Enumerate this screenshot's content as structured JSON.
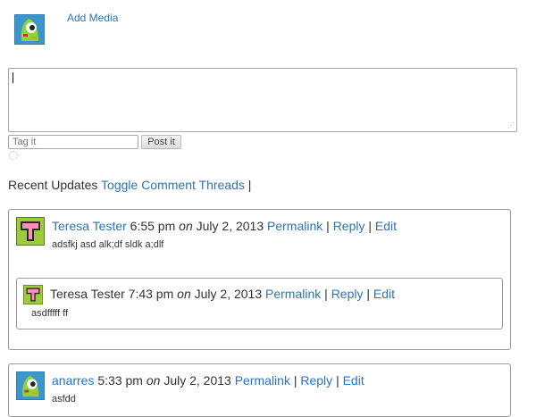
{
  "composer": {
    "add_media_label": "Add Media",
    "textarea_value": "",
    "tag_placeholder": "Tag it",
    "post_button_label": "Post it"
  },
  "recent_bar": {
    "title": "Recent Updates",
    "toggle_label": "Toggle Comment Threads",
    "separator": "|"
  },
  "threads": [
    {
      "author": "Teresa Tester",
      "time": "6:55 pm",
      "on": "on",
      "date": "July 2, 2013",
      "permalink": "Permalink",
      "reply": "Reply",
      "edit": "Edit",
      "sep": "|",
      "body": "adsfkj asd alk;df sldk a;dlf",
      "replies": [
        {
          "author": "Teresa Tester",
          "time": "7:43 pm",
          "on": "on",
          "date": "July 2, 2013",
          "permalink": "Permalink",
          "reply": "Reply",
          "edit": "Edit",
          "sep": "|",
          "body": "asdfffff ff"
        }
      ]
    },
    {
      "author": "anarres",
      "time": "5:33 pm",
      "on": "on",
      "date": "July 2, 2013",
      "permalink": "Permalink",
      "reply": "Reply",
      "edit": "Edit",
      "sep": "|",
      "body": "asfdd"
    }
  ],
  "colors": {
    "link": "#2e72b8",
    "text": "#333333",
    "border": "#999999"
  },
  "icons": {
    "composer_avatar": "green-monster-avatar-icon",
    "teresa_avatar": "pink-robot-avatar-icon",
    "anarres_avatar": "green-monster-avatar-icon"
  }
}
